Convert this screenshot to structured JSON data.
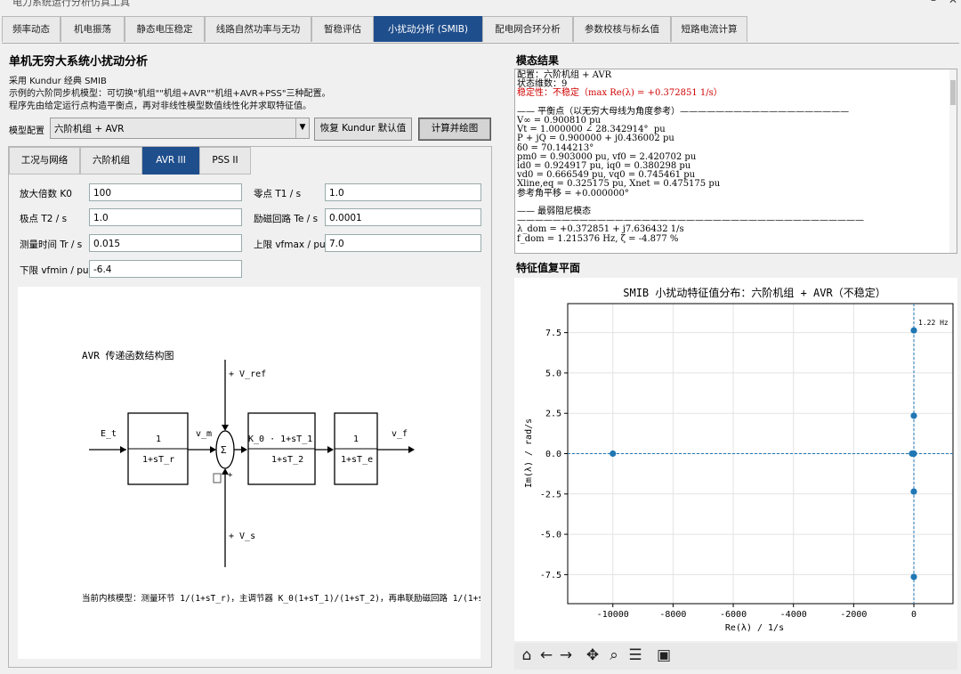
{
  "window": {
    "title": "电力系统运行分析仿真工具"
  },
  "main_tabs": [
    {
      "label": "频率动态"
    },
    {
      "label": "机电振荡"
    },
    {
      "label": "静态电压稳定"
    },
    {
      "label": "线路自然功率与无功"
    },
    {
      "label": "暂稳评估"
    },
    {
      "label": "小扰动分析 (SMIB)"
    },
    {
      "label": "配电网合环分析"
    },
    {
      "label": "参数校核与标幺值"
    },
    {
      "label": "短路电流计算"
    }
  ],
  "left": {
    "title": "单机无穷大系统小扰动分析",
    "desc": [
      "采用 Kundur 经典 SMIB",
      "示例的六阶同步机模型：可切换\"机组\"\"机组+AVR\"\"机组+AVR+PSS\"三种配置。",
      "程序先由给定运行点构造平衡点，再对非线性模型数值线性化并求取特征值。"
    ],
    "model_label": "模型配置",
    "model_value": "六阶机组 + AVR",
    "btn_reset": "恢复 Kundur 默认值",
    "btn_compute": "计算并绘图",
    "tabs": [
      {
        "label": "工况与网络"
      },
      {
        "label": "六阶机组"
      },
      {
        "label": "AVR III"
      },
      {
        "label": "PSS II"
      }
    ],
    "params": {
      "k0_label": "放大倍数 K0",
      "k0": "100",
      "t1_label": "零点 T1 / s",
      "t1": "1.0",
      "t2_label": "极点 T2 / s",
      "t2": "1.0",
      "te_label": "励磁回路 Te / s",
      "te": "0.0001",
      "tr_label": "测量时间 Tr / s",
      "tr": "0.015",
      "vfmax_label": "上限 vfmax / pu",
      "vfmax": "7.0",
      "vfmin_label": "下限 vfmin / pu",
      "vfmin": "-6.4"
    },
    "diagram": {
      "title": "AVR 传递函数结构图",
      "vref": "+   V_ref",
      "vs": "+   V_s",
      "et": "E_t",
      "vm": "v_m",
      "vf": "v_f",
      "block1_num": "1",
      "block1_den": "1+sT_r",
      "block2_num": "K_0 · 1+sT_1",
      "block2_den": "1+sT_2",
      "block3_num": "1",
      "block3_den": "1+sT_e",
      "sigma": "Σ",
      "minus": "−",
      "plus": "+",
      "caption": "当前内核模型：测量环节 1/(1+sT_r)，主调节器 K_0(1+sT_1)/(1+sT_2)，再串联励磁回路 1/(1+sT_"
    }
  },
  "right": {
    "modal_title": "模态结果",
    "modal_lines": [
      {
        "text": "配置：六阶机组 + AVR",
        "color": "#000"
      },
      {
        "text": "状态维数：9",
        "color": "#000"
      },
      {
        "text": "稳定性：不稳定（max Re(λ) = +0.372851 1/s）",
        "color": "#d00000"
      },
      {
        "text": "",
        "color": "#000"
      },
      {
        "text": "—— 平衡点（以无穷大母线为角度参考）———————————————————",
        "color": "#000"
      },
      {
        "text": "V∞ = 0.900810 pu",
        "color": "#000"
      },
      {
        "text": "Vt = 1.000000 ∠ 28.342914°  pu",
        "color": "#000"
      },
      {
        "text": "P + jQ = 0.900000 + j0.436002 pu",
        "color": "#000"
      },
      {
        "text": "δ0 = 70.144213°",
        "color": "#000"
      },
      {
        "text": "pm0 = 0.903000 pu, vf0 = 2.420702 pu",
        "color": "#000"
      },
      {
        "text": "id0 = 0.924917 pu, iq0 = 0.380298 pu",
        "color": "#000"
      },
      {
        "text": "vd0 = 0.666549 pu, vq0 = 0.745461 pu",
        "color": "#000"
      },
      {
        "text": "Xline,eq = 0.325175 pu, Xnet = 0.475175 pu",
        "color": "#000"
      },
      {
        "text": "参考角平移 = +0.000000°",
        "color": "#000"
      },
      {
        "text": "",
        "color": "#000"
      },
      {
        "text": "—— 最弱阻尼模态",
        "color": "#000"
      },
      {
        "text": "———————————————————————————————————————",
        "color": "#000"
      },
      {
        "text": "λ_dom = +0.372851 + j7.636432 1/s",
        "color": "#000"
      },
      {
        "text": "f_dom = 1.215376 Hz, ζ = -4.877 %",
        "color": "#000"
      }
    ],
    "plane_title": "特征值复平面",
    "toolbar": [
      {
        "name": "home-icon",
        "glyph": "⌂"
      },
      {
        "name": "back-icon",
        "glyph": "←"
      },
      {
        "name": "forward-icon",
        "glyph": "→"
      },
      {
        "name": "pan-icon",
        "glyph": "✥"
      },
      {
        "name": "zoom-icon",
        "glyph": "⌕"
      },
      {
        "name": "configure-icon",
        "glyph": "☰"
      },
      {
        "name": "save-icon",
        "glyph": "▣"
      }
    ]
  },
  "chart_data": {
    "type": "scatter",
    "title": "SMIB 小扰动特征值分布：六阶机组 + AVR（不稳定）",
    "xlabel": "Re(λ) / 1/s",
    "ylabel": "Im(λ) / rad/s",
    "xlim": [
      -11500,
      1300
    ],
    "ylim": [
      -9.3,
      9.3
    ],
    "xticks": [
      -10000,
      -8000,
      -6000,
      -4000,
      -2000,
      0
    ],
    "yticks": [
      -7.5,
      -5.0,
      -2.5,
      0.0,
      2.5,
      5.0,
      7.5
    ],
    "grid": true,
    "points": [
      {
        "x": -10000,
        "y": 0
      },
      {
        "x": 0.37,
        "y": 7.64
      },
      {
        "x": 0.37,
        "y": -7.64
      },
      {
        "x": -1.0,
        "y": 2.35
      },
      {
        "x": -1.0,
        "y": -2.35
      },
      {
        "x": -30,
        "y": 0
      },
      {
        "x": -5,
        "y": 0
      },
      {
        "x": -1,
        "y": 0
      },
      {
        "x": -60,
        "y": 0
      }
    ],
    "annotation": {
      "text": "1.22 Hz",
      "x": 0.37,
      "y": 7.64
    },
    "color": "#1f77b4"
  }
}
